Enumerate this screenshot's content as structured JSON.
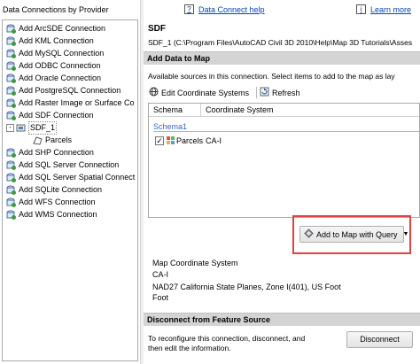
{
  "left_panel": {
    "title": "Data Connections by Provider",
    "items": [
      {
        "label": "Add ArcSDE Connection",
        "icon": "db-add-icon"
      },
      {
        "label": "Add KML Connection",
        "icon": "db-add-icon"
      },
      {
        "label": "Add MySQL Connection",
        "icon": "db-add-icon"
      },
      {
        "label": "Add ODBC Connection",
        "icon": "db-add-icon"
      },
      {
        "label": "Add Oracle Connection",
        "icon": "db-add-icon"
      },
      {
        "label": "Add PostgreSQL Connection",
        "icon": "db-add-icon"
      },
      {
        "label": "Add Raster Image or Surface Co",
        "icon": "db-add-icon"
      },
      {
        "label": "Add SDF Connection",
        "icon": "db-add-icon"
      },
      {
        "label": "SDF_1",
        "icon": "connection-icon"
      },
      {
        "label": "Parcels",
        "icon": "polygon-layer-icon"
      },
      {
        "label": "Add SHP Connection",
        "icon": "db-add-icon"
      },
      {
        "label": "Add SQL Server Connection",
        "icon": "db-add-icon"
      },
      {
        "label": "Add SQL Server Spatial Connect",
        "icon": "db-add-icon"
      },
      {
        "label": "Add SQLite Connection",
        "icon": "db-add-icon"
      },
      {
        "label": "Add WFS Connection",
        "icon": "db-add-icon"
      },
      {
        "label": "Add WMS Connection",
        "icon": "db-add-icon"
      }
    ]
  },
  "header": {
    "help_link": "Data Connect help",
    "learn_more": "Learn more"
  },
  "connection": {
    "name": "SDF",
    "path": "SDF_1  (C:\\Program Files\\AutoCAD Civil 3D 2010\\Help\\Map 3D Tutorials\\Asses"
  },
  "add_data": {
    "section_title": "Add Data to Map",
    "available_text": "Available sources in this connection.  Select items to add to the map as lay",
    "edit_cs_label": "Edit Coordinate Systems",
    "refresh_label": "Refresh",
    "columns": [
      "Schema",
      "Coordinate System"
    ],
    "group_name": "Schema1",
    "row": {
      "checked": "✓",
      "name": "Parcels",
      "cs": "CA-I"
    },
    "add_button_label": "Add to Map with Query"
  },
  "map_cs": {
    "title": "Map Coordinate System",
    "code": "CA-I",
    "description": "NAD27 California State Planes, Zone I(401), US Foot",
    "unit": "Foot"
  },
  "disconnect": {
    "section_title": "Disconnect from Feature Source",
    "text_line1": "To reconfigure this connection, disconnect, and",
    "text_line2": "then edit the information.",
    "button_label": "Disconnect"
  },
  "colors": {
    "highlight": "#e04343",
    "link": "#0645ad",
    "section_bg": "#d4d4d4"
  }
}
